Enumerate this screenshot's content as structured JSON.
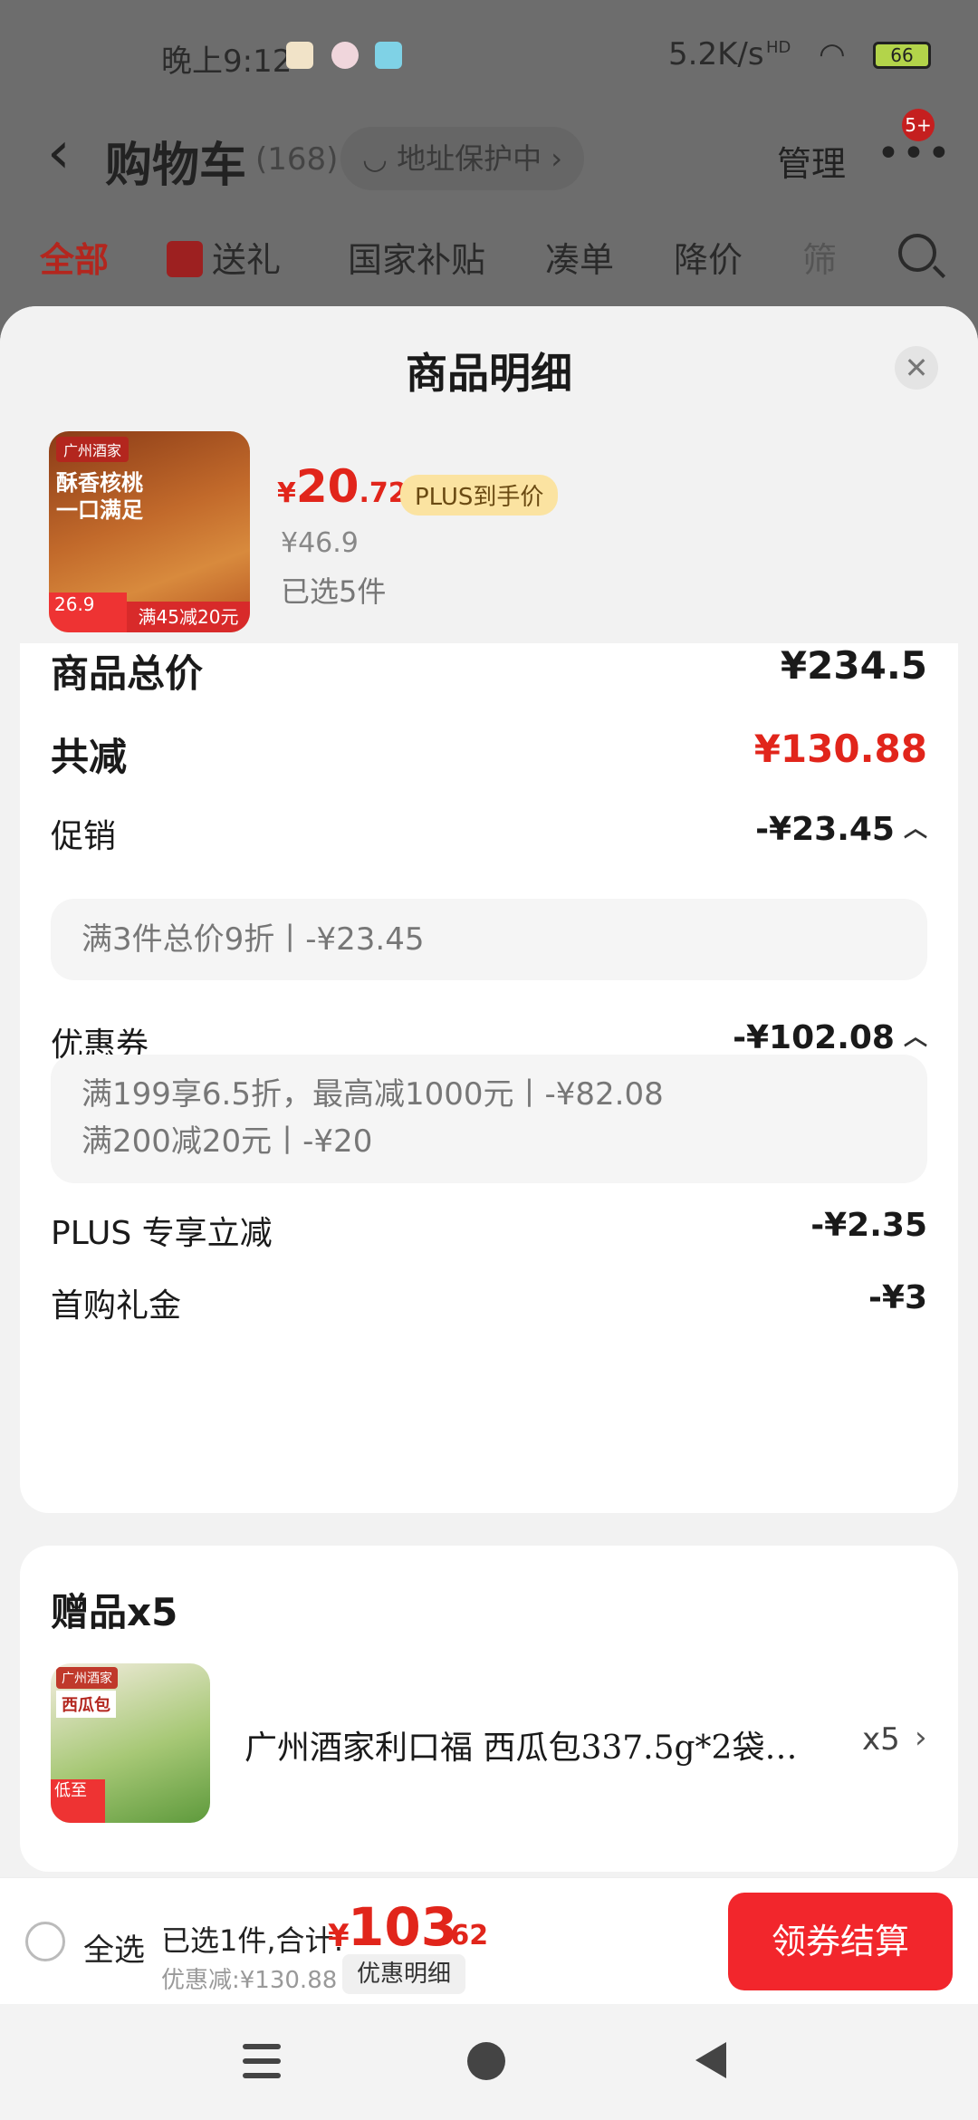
{
  "status_bar": {
    "time": "晚上9:12",
    "network_speed": "5.2K/s",
    "signal": "HD",
    "battery": "66"
  },
  "header": {
    "back_icon": "chevron-left-icon",
    "title": "购物车",
    "count": "(168)",
    "address_protect": "地址保护中",
    "manage": "管理",
    "more_badge": "5+"
  },
  "tabs": [
    {
      "label": "全部"
    },
    {
      "label": "送礼"
    },
    {
      "label": "国家补贴"
    },
    {
      "label": "凑单"
    },
    {
      "label": "降价"
    },
    {
      "label": "筛"
    }
  ],
  "sheet": {
    "title": "商品明细",
    "close_icon": "close-icon"
  },
  "product": {
    "image_brand": "广州酒家",
    "image_headline_1": "酥香核桃",
    "image_headline_2": "一口满足",
    "image_price_badge": "26.9",
    "image_promo": "满45减20元",
    "price_yen": "¥",
    "price_int": "20",
    "price_dec": ".72",
    "plus_tag": "PLUS到手价",
    "original_price": "¥46.9",
    "selected_count": "已选5件"
  },
  "breakdown": {
    "total_label": "商品总价",
    "total_value": "¥234.5",
    "reduce_label": "共减",
    "reduce_value": "¥130.88",
    "promo_label": "促销",
    "promo_value": "-¥23.45",
    "promo_items": [
      "满3件总价9折丨-¥23.45"
    ],
    "coupon_label": "优惠券",
    "coupon_value": "-¥102.08",
    "coupon_items": [
      "满199享6.5折，最高减1000元丨-¥82.08",
      "满200减20元丨-¥20"
    ],
    "plus_label": "PLUS 专享立减",
    "plus_value": "-¥2.35",
    "first_label": "首购礼金",
    "first_value": "-¥3"
  },
  "gift": {
    "title": "赠品x5",
    "image_brand": "广州酒家",
    "image_label": "西瓜包",
    "image_price": "低至",
    "name": "广州酒家利口福 西瓜包337.5g*2袋…",
    "qty": "x5"
  },
  "bottom_bar": {
    "select_all": "全选",
    "summary": "已选1件,合计:",
    "total_yen": "¥",
    "total_int": "103",
    "total_dec": ".62",
    "discount": "优惠减:¥130.88",
    "detail_button": "优惠明细",
    "checkout_button": "领券结算"
  },
  "colors": {
    "accent_red": "#e1251b",
    "checkout_red": "#f2262c",
    "plus_gold": "#fbe3a1"
  }
}
